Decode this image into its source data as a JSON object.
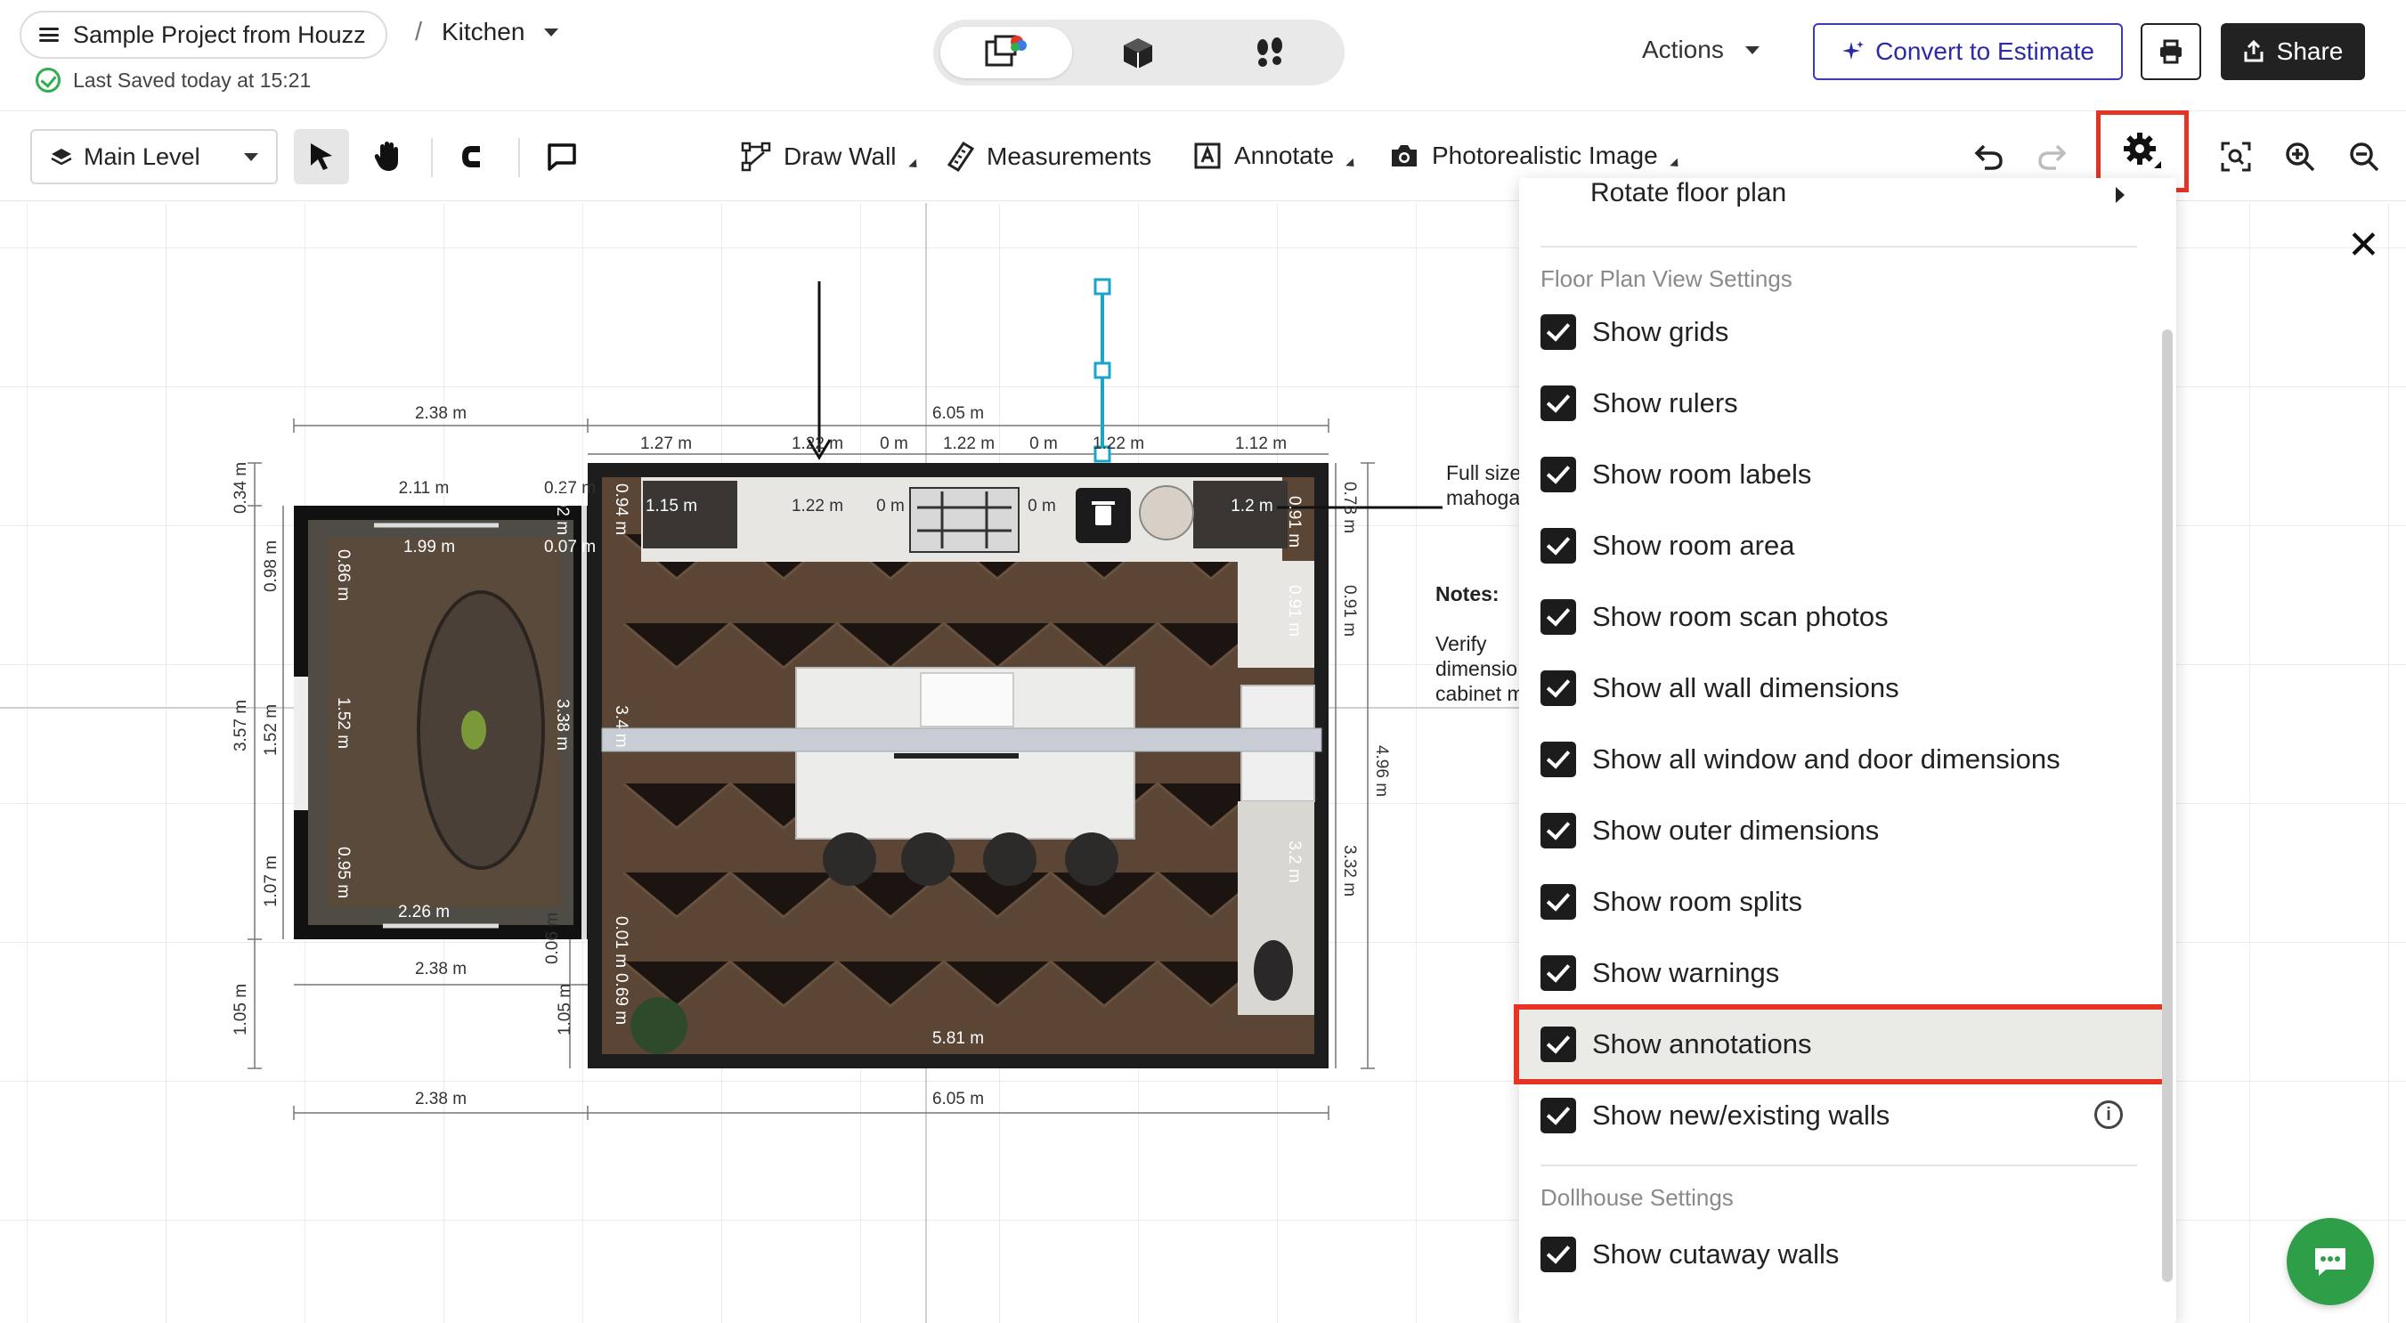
{
  "header": {
    "project_name": "Sample Project from Houzz",
    "separator": "/",
    "room_name": "Kitchen",
    "saved_status": "Last Saved today at 15:21",
    "actions_label": "Actions",
    "convert_label": "Convert to Estimate",
    "share_label": "Share"
  },
  "view_modes": [
    "floor-plan-2d",
    "dollhouse-3d",
    "walkthrough"
  ],
  "toolbar": {
    "level": "Main Level",
    "draw_wall": "Draw Wall",
    "measurements": "Measurements",
    "annotate": "Annotate",
    "photoreal": "Photorealistic Image"
  },
  "plan": {
    "dims": {
      "top_left_outer": "2.38 m",
      "top_total": "6.05 m",
      "top_seg1": "1.27 m",
      "top_seg2": "1.22 m",
      "top_seg3": "0 m",
      "top_seg4": "1.22 m",
      "top_seg5": "0 m",
      "top_seg6": "1.22 m",
      "top_seg7": "1.12 m",
      "dining_top": "2.11 m",
      "small_027": "0.27 m",
      "dining_inner": "1.99 m",
      "dining_small": "0.07 m",
      "counter_115": "1.15 m",
      "counter_122": "1.22 m",
      "zero_a": "0 m",
      "zero_b": "0 m",
      "counter_right": "1.2 m",
      "left_034": "0.34 m",
      "left_098": "0.98 m",
      "left_357": "3.57 m",
      "left_152": "1.52 m",
      "left_107": "1.07 m",
      "left_105a": "1.05 m",
      "left_105b": "1.05 m",
      "dining_086": "0.86 m",
      "dining_152": "1.52 m",
      "dining_095": "0.95 m",
      "dining_bottom": "2.26 m",
      "mid_338": "3.38 m",
      "mid_34": "3.4 m",
      "mid_094": "0.94 m",
      "mid_002": "0.02 m",
      "right_073": "0.73 m",
      "right_091": "0.91 m",
      "right_496": "4.96 m",
      "right_332": "3.32 m",
      "inner_091a": "0.91 m",
      "inner_091b": "0.91 m",
      "inner_32": "3.2 m",
      "bottom_left": "2.38 m",
      "bottom_total": "6.05 m",
      "bottom_left2": "2.38 m",
      "kitchen_bottom": "5.81 m",
      "mid_006": "0.06 m",
      "mid_001": "0.01 m",
      "mid_009": "0.69 m"
    },
    "notes_heading": "Notes:",
    "note_lines": [
      "Verify",
      "dimensio",
      "cabinet m"
    ],
    "callout_lines": [
      "Full size",
      "mahoga"
    ]
  },
  "settings_menu": {
    "rotate_label": "Rotate floor plan",
    "section_floor": "Floor Plan View Settings",
    "items": [
      {
        "label": "Show grids",
        "checked": true
      },
      {
        "label": "Show rulers",
        "checked": true
      },
      {
        "label": "Show room labels",
        "checked": true
      },
      {
        "label": "Show room area",
        "checked": true
      },
      {
        "label": "Show room scan photos",
        "checked": true
      },
      {
        "label": "Show all wall dimensions",
        "checked": true
      },
      {
        "label": "Show all window and door dimensions",
        "checked": true
      },
      {
        "label": "Show outer dimensions",
        "checked": true
      },
      {
        "label": "Show room splits",
        "checked": true
      },
      {
        "label": "Show warnings",
        "checked": true
      },
      {
        "label": "Show annotations",
        "checked": true
      },
      {
        "label": "Show new/existing walls",
        "checked": true
      }
    ],
    "section_dollhouse": "Dollhouse Settings",
    "dollhouse_items": [
      {
        "label": "Show cutaway walls",
        "checked": true
      }
    ]
  },
  "colors": {
    "accent_red": "#e53324",
    "convert_blue": "#3b3bb8",
    "chat_green": "#2e9e48",
    "floor_wood": "#5b4636",
    "wall": "#1e1e1e"
  }
}
